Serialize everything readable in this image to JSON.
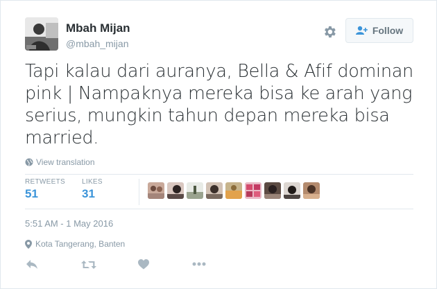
{
  "user": {
    "name": "Mbah Mijan",
    "handle": "@mbah_mijan"
  },
  "follow": {
    "label": "Follow"
  },
  "tweet": {
    "text": "Tapi kalau dari auranya, Bella & Afif dominan pink | Nampaknya mereka bisa ke arah yang serius, mungkin tahun depan mereka bisa married."
  },
  "translate": {
    "label": "View translation"
  },
  "stats": {
    "retweets_label": "RETWEETS",
    "retweets_value": "51",
    "likes_label": "LIKES",
    "likes_value": "31"
  },
  "timestamp": "5:51 AM - 1 May 2016",
  "location": "Kota Tangerang, Banten",
  "colors": {
    "text": "#292f33",
    "muted": "#8899a6",
    "accent": "#3b94d9",
    "border": "#e1e8ed"
  },
  "icons": {
    "settings": "gear-icon",
    "follow": "add-user-icon",
    "translate": "globe-icon",
    "location": "map-pin-icon",
    "reply": "reply-icon",
    "retweet": "retweet-icon",
    "like": "heart-icon",
    "more": "more-icon"
  }
}
